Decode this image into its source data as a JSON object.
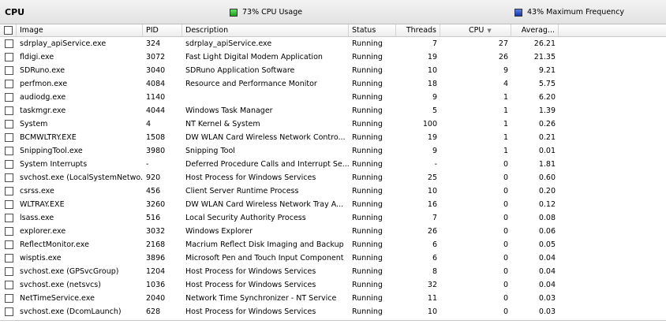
{
  "header": {
    "title": "CPU",
    "cpu_usage": "73% CPU Usage",
    "max_frequency": "43% Maximum Frequency"
  },
  "columns": {
    "image": "Image",
    "pid": "PID",
    "description": "Description",
    "status": "Status",
    "threads": "Threads",
    "cpu": "CPU",
    "average": "Averag..."
  },
  "sort": {
    "column": "CPU",
    "direction": "descending",
    "icon": "sort-down-icon"
  },
  "colors": {
    "cpu_usage": "#1aa31a",
    "max_frequency": "#1335b4"
  },
  "rows": [
    {
      "image": "sdrplay_apiService.exe",
      "pid": "324",
      "description": "sdrplay_apiService.exe",
      "status": "Running",
      "threads": "7",
      "cpu": "27",
      "avg": "26.21"
    },
    {
      "image": "fldigi.exe",
      "pid": "3072",
      "description": "Fast Light Digital Modem Application",
      "status": "Running",
      "threads": "19",
      "cpu": "26",
      "avg": "21.35"
    },
    {
      "image": "SDRuno.exe",
      "pid": "3040",
      "description": "SDRuno Application Software",
      "status": "Running",
      "threads": "10",
      "cpu": "9",
      "avg": "9.21"
    },
    {
      "image": "perfmon.exe",
      "pid": "4084",
      "description": "Resource and Performance Monitor",
      "status": "Running",
      "threads": "18",
      "cpu": "4",
      "avg": "5.75"
    },
    {
      "image": "audiodg.exe",
      "pid": "1140",
      "description": "",
      "status": "Running",
      "threads": "9",
      "cpu": "1",
      "avg": "6.20"
    },
    {
      "image": "taskmgr.exe",
      "pid": "4044",
      "description": "Windows Task Manager",
      "status": "Running",
      "threads": "5",
      "cpu": "1",
      "avg": "1.39"
    },
    {
      "image": "System",
      "pid": "4",
      "description": "NT Kernel & System",
      "status": "Running",
      "threads": "100",
      "cpu": "1",
      "avg": "0.26"
    },
    {
      "image": "BCMWLTRY.EXE",
      "pid": "1508",
      "description": "DW WLAN Card Wireless Network Contro...",
      "status": "Running",
      "threads": "19",
      "cpu": "1",
      "avg": "0.21"
    },
    {
      "image": "SnippingTool.exe",
      "pid": "3980",
      "description": "Snipping Tool",
      "status": "Running",
      "threads": "9",
      "cpu": "1",
      "avg": "0.01"
    },
    {
      "image": "System Interrupts",
      "pid": "-",
      "description": "Deferred Procedure Calls and Interrupt Se...",
      "status": "Running",
      "threads": "-",
      "cpu": "0",
      "avg": "1.81"
    },
    {
      "image": "svchost.exe (LocalSystemNetwo...",
      "pid": "920",
      "description": "Host Process for Windows Services",
      "status": "Running",
      "threads": "25",
      "cpu": "0",
      "avg": "0.60"
    },
    {
      "image": "csrss.exe",
      "pid": "456",
      "description": "Client Server Runtime Process",
      "status": "Running",
      "threads": "10",
      "cpu": "0",
      "avg": "0.20"
    },
    {
      "image": "WLTRAY.EXE",
      "pid": "3260",
      "description": "DW WLAN Card Wireless Network Tray A...",
      "status": "Running",
      "threads": "16",
      "cpu": "0",
      "avg": "0.12"
    },
    {
      "image": "lsass.exe",
      "pid": "516",
      "description": "Local Security Authority Process",
      "status": "Running",
      "threads": "7",
      "cpu": "0",
      "avg": "0.08"
    },
    {
      "image": "explorer.exe",
      "pid": "3032",
      "description": "Windows Explorer",
      "status": "Running",
      "threads": "26",
      "cpu": "0",
      "avg": "0.06"
    },
    {
      "image": "ReflectMonitor.exe",
      "pid": "2168",
      "description": "Macrium Reflect Disk Imaging and Backup",
      "status": "Running",
      "threads": "6",
      "cpu": "0",
      "avg": "0.05"
    },
    {
      "image": "wisptis.exe",
      "pid": "3896",
      "description": "Microsoft Pen and Touch Input Component",
      "status": "Running",
      "threads": "6",
      "cpu": "0",
      "avg": "0.04"
    },
    {
      "image": "svchost.exe (GPSvcGroup)",
      "pid": "1204",
      "description": "Host Process for Windows Services",
      "status": "Running",
      "threads": "8",
      "cpu": "0",
      "avg": "0.04"
    },
    {
      "image": "svchost.exe (netsvcs)",
      "pid": "1036",
      "description": "Host Process for Windows Services",
      "status": "Running",
      "threads": "32",
      "cpu": "0",
      "avg": "0.04"
    },
    {
      "image": "NetTimeService.exe",
      "pid": "2040",
      "description": "Network Time Synchronizer - NT Service",
      "status": "Running",
      "threads": "11",
      "cpu": "0",
      "avg": "0.03"
    },
    {
      "image": "svchost.exe (DcomLaunch)",
      "pid": "628",
      "description": "Host Process for Windows Services",
      "status": "Running",
      "threads": "10",
      "cpu": "0",
      "avg": "0.03"
    }
  ]
}
